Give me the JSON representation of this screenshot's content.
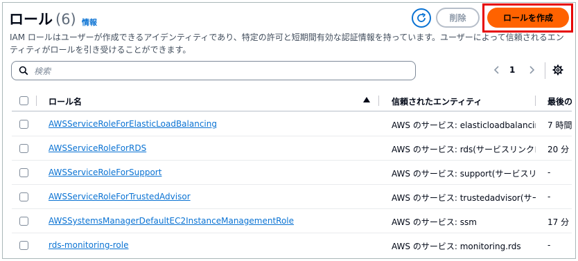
{
  "header": {
    "title": "ロール",
    "count": "(6)",
    "info_link": "情報",
    "delete_label": "削除",
    "create_label": "ロールを作成"
  },
  "description": "IAM ロールはユーザーが作成できるアイデンティティであり、特定の許可と短期間有効な認証情報を持っています。ユーザーによって信頼されるエンティティがロールを引き受けることができます。",
  "search": {
    "placeholder": "検索"
  },
  "pagination": {
    "current_page": "1"
  },
  "table": {
    "columns": [
      "ロール名",
      "信頼されたエンティティ",
      "最後の"
    ],
    "rows": [
      {
        "name": "AWSServiceRoleForElasticLoadBalancing",
        "entity": "AWS のサービス: elasticloadbalancing",
        "last": "7 時間"
      },
      {
        "name": "AWSServiceRoleForRDS",
        "entity": "AWS のサービス: rds(サービスリンクロール)",
        "last": "20 分"
      },
      {
        "name": "AWSServiceRoleForSupport",
        "entity": "AWS のサービス: support(サービスリンクロール)",
        "last": "-"
      },
      {
        "name": "AWSServiceRoleForTrustedAdvisor",
        "entity": "AWS のサービス: trustedadvisor(サービスリンクロール)",
        "last": "-"
      },
      {
        "name": "AWSSystemsManagerDefaultEC2InstanceManagementRole",
        "entity": "AWS のサービス: ssm",
        "last": "17 分"
      },
      {
        "name": "rds-monitoring-role",
        "entity": "AWS のサービス: monitoring.rds",
        "last": "-"
      }
    ]
  },
  "colors": {
    "accent": "#0972d3",
    "primary_button": "#ff6200",
    "highlight_outline": "#e60000"
  }
}
